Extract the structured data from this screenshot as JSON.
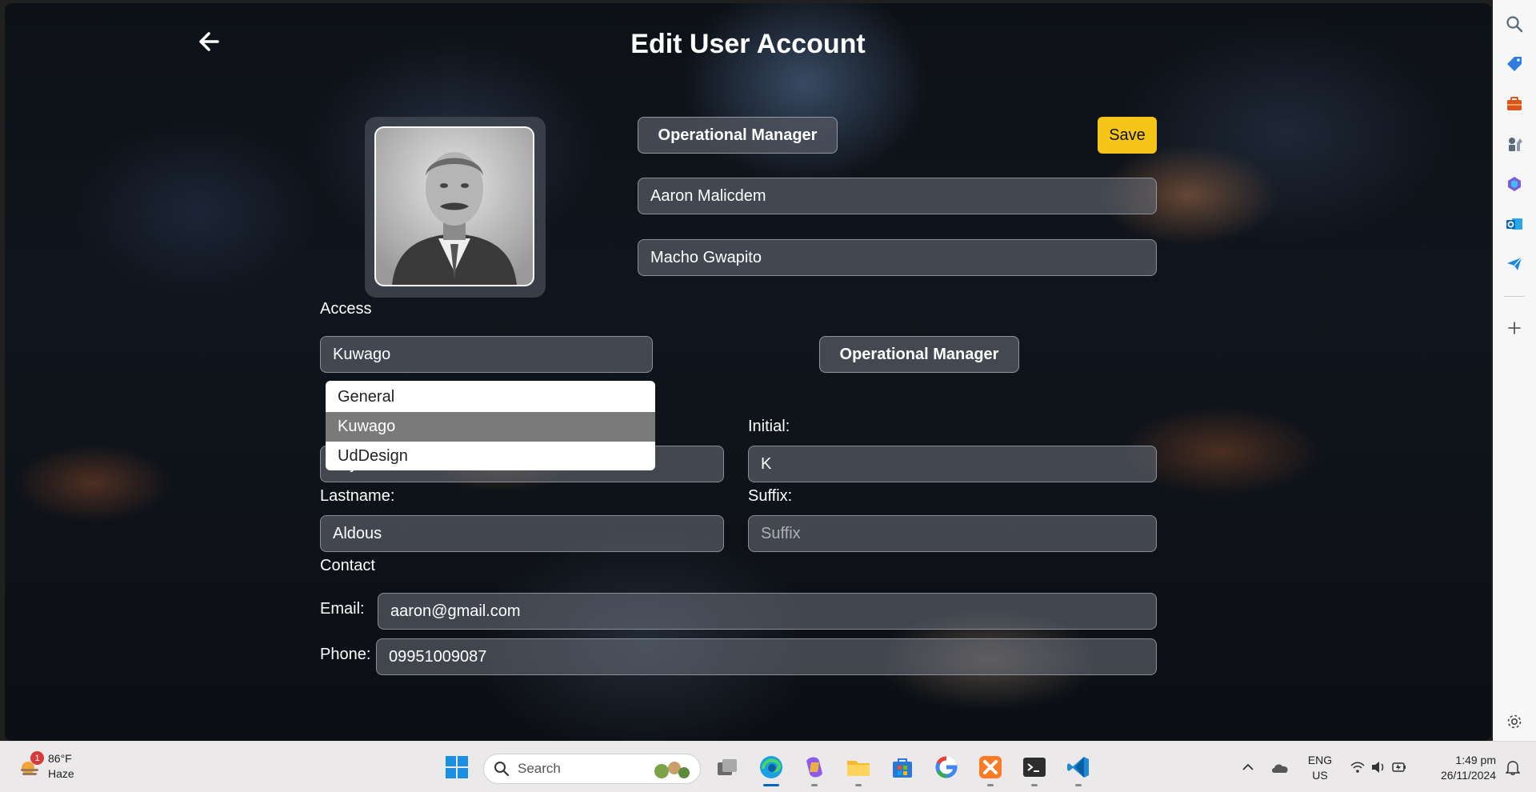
{
  "page": {
    "title": "Edit User Account",
    "role_badge": "Operational Manager",
    "save_label": "Save",
    "fullname_value": "Aaron Malicdem",
    "nickname_value": "Macho Gwapito",
    "access_label": "Access",
    "access_value": "Kuwago",
    "access_options": [
      "General",
      "Kuwago",
      "UdDesign"
    ],
    "access_selected": "Kuwago",
    "role_badge_2": "Operational Manager",
    "firstname_partial": "Miya",
    "initial_label": "Initial:",
    "initial_value": "K",
    "lastname_label": "Lastname:",
    "lastname_value": "Aldous",
    "suffix_label": "Suffix:",
    "suffix_placeholder": "Suffix",
    "contact_label": "Contact",
    "email_label": "Email:",
    "email_value": "aaron@gmail.com",
    "phone_label": "Phone:",
    "phone_value": "09951009087"
  },
  "sidebar": {
    "icons": [
      "search-icon",
      "tag-icon",
      "briefcase-icon",
      "chess-icon",
      "copilot-icon",
      "outlook-icon",
      "send-icon",
      "add-icon",
      "settings-icon"
    ]
  },
  "taskbar": {
    "weather_badge": "1",
    "weather_temp": "86°F",
    "weather_cond": "Haze",
    "search_label": "Search",
    "lang_line1": "ENG",
    "lang_line2": "US",
    "time": "1:49 pm",
    "date": "26/11/2024"
  },
  "colors": {
    "accent_save": "#f5c518",
    "taskbar_bg": "#ece9ea"
  }
}
